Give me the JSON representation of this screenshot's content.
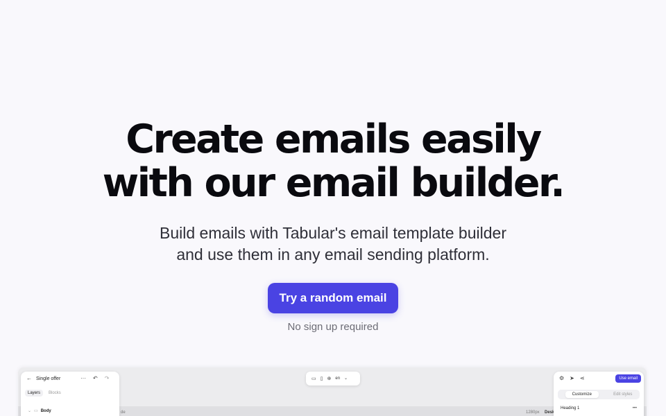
{
  "hero": {
    "headline_line1": "Create emails easily",
    "headline_line2": "with our email builder.",
    "subhead_line1": "Build emails with Tabular's email template builder",
    "subhead_line2": "and use them in any email sending platform.",
    "cta_label": "Try a random email",
    "cta_note": "No sign up required"
  },
  "colors": {
    "accent": "#4a43e3",
    "background": "#f9f8fc"
  },
  "editor_preview": {
    "left_panel": {
      "back_icon": "arrow-left-icon",
      "title": "Single offer",
      "more_icon": "more-horizontal-icon",
      "undo_icon": "undo-icon",
      "redo_icon": "redo-icon",
      "tabs": [
        "Layers",
        "Blocks"
      ],
      "layer_item": "Body"
    },
    "center_toolbar": {
      "desktop_icon": "monitor-icon",
      "mobile_icon": "smartphone-icon",
      "language": "en",
      "globe_icon": "globe-icon",
      "chevron_icon": "chevron-down-icon"
    },
    "canvas_strip": {
      "left_label": "de",
      "width_label": "1280px",
      "device_label": "Desk"
    },
    "right_panel": {
      "settings_icon": "gear-icon",
      "send_icon": "send-icon",
      "share_icon": "share-icon",
      "use_email_label": "Use email",
      "tabs": [
        "Customize",
        "Edit styles"
      ],
      "field_label": "Heading 1",
      "more": "•••"
    }
  }
}
